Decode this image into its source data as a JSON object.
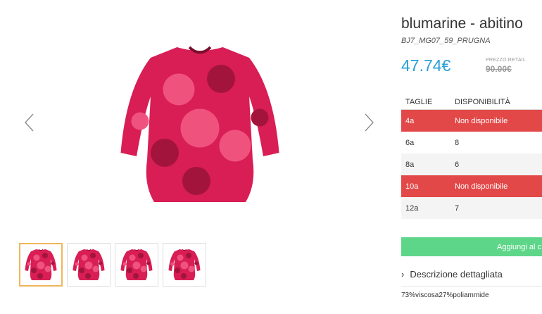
{
  "product": {
    "title": "blumarine - abitino",
    "sku": "BJ7_MG07_59_PRUGNA",
    "price": "47.74€",
    "retail_label": "PREZZO RETAIL",
    "retail_price": "90.00€"
  },
  "sizes_table": {
    "headers": {
      "size": "TAGLIE",
      "availability": "DISPONIBILITÀ"
    },
    "rows": [
      {
        "size": "4a",
        "availability": "Non disponibile"
      },
      {
        "size": "6a",
        "availability": "8"
      },
      {
        "size": "8a",
        "availability": "6"
      },
      {
        "size": "10a",
        "availability": "Non disponibile"
      },
      {
        "size": "12a",
        "availability": "7"
      }
    ]
  },
  "cart_button_label": "Aggiungi al c",
  "description": {
    "toggle_label": "Descrizione dettagliata",
    "composition": "73%viscosa27%poliammide"
  },
  "colors": {
    "price": "#2a9fd8",
    "unavailable": "#e34848",
    "cart": "#5ed689",
    "thumb_active_border": "#f0b55a",
    "dress_base": "#d81e55"
  },
  "icons": {
    "prev": "chevron-left-icon",
    "next": "chevron-right-icon",
    "desc": "chevron-right-small-icon"
  }
}
